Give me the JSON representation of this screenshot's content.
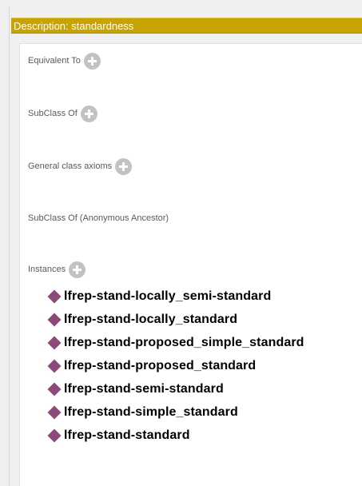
{
  "description_panel": {
    "title": "Description: standardness",
    "sections": {
      "equivalent_to": "Equivalent To",
      "subclass_of": "SubClass Of",
      "general_class_axioms": "General class axioms",
      "subclass_of_anonymous_ancestor": "SubClass Of (Anonymous Ancestor)",
      "instances": "Instances"
    },
    "instances": [
      "lfrep-stand-locally_semi-standard",
      "lfrep-stand-locally_standard",
      "lfrep-stand-proposed_simple_standard",
      "lfrep-stand-proposed_standard",
      "lfrep-stand-semi-standard",
      "lfrep-stand-simple_standard",
      "lfrep-stand-standard"
    ]
  },
  "icons": {
    "add": "add-circle-icon",
    "individual": "individual-diamond-icon"
  },
  "colors": {
    "title_bar": "#c9a400",
    "individual_diamond": "#8a4a7a",
    "add_button": "#c2c2c2"
  }
}
